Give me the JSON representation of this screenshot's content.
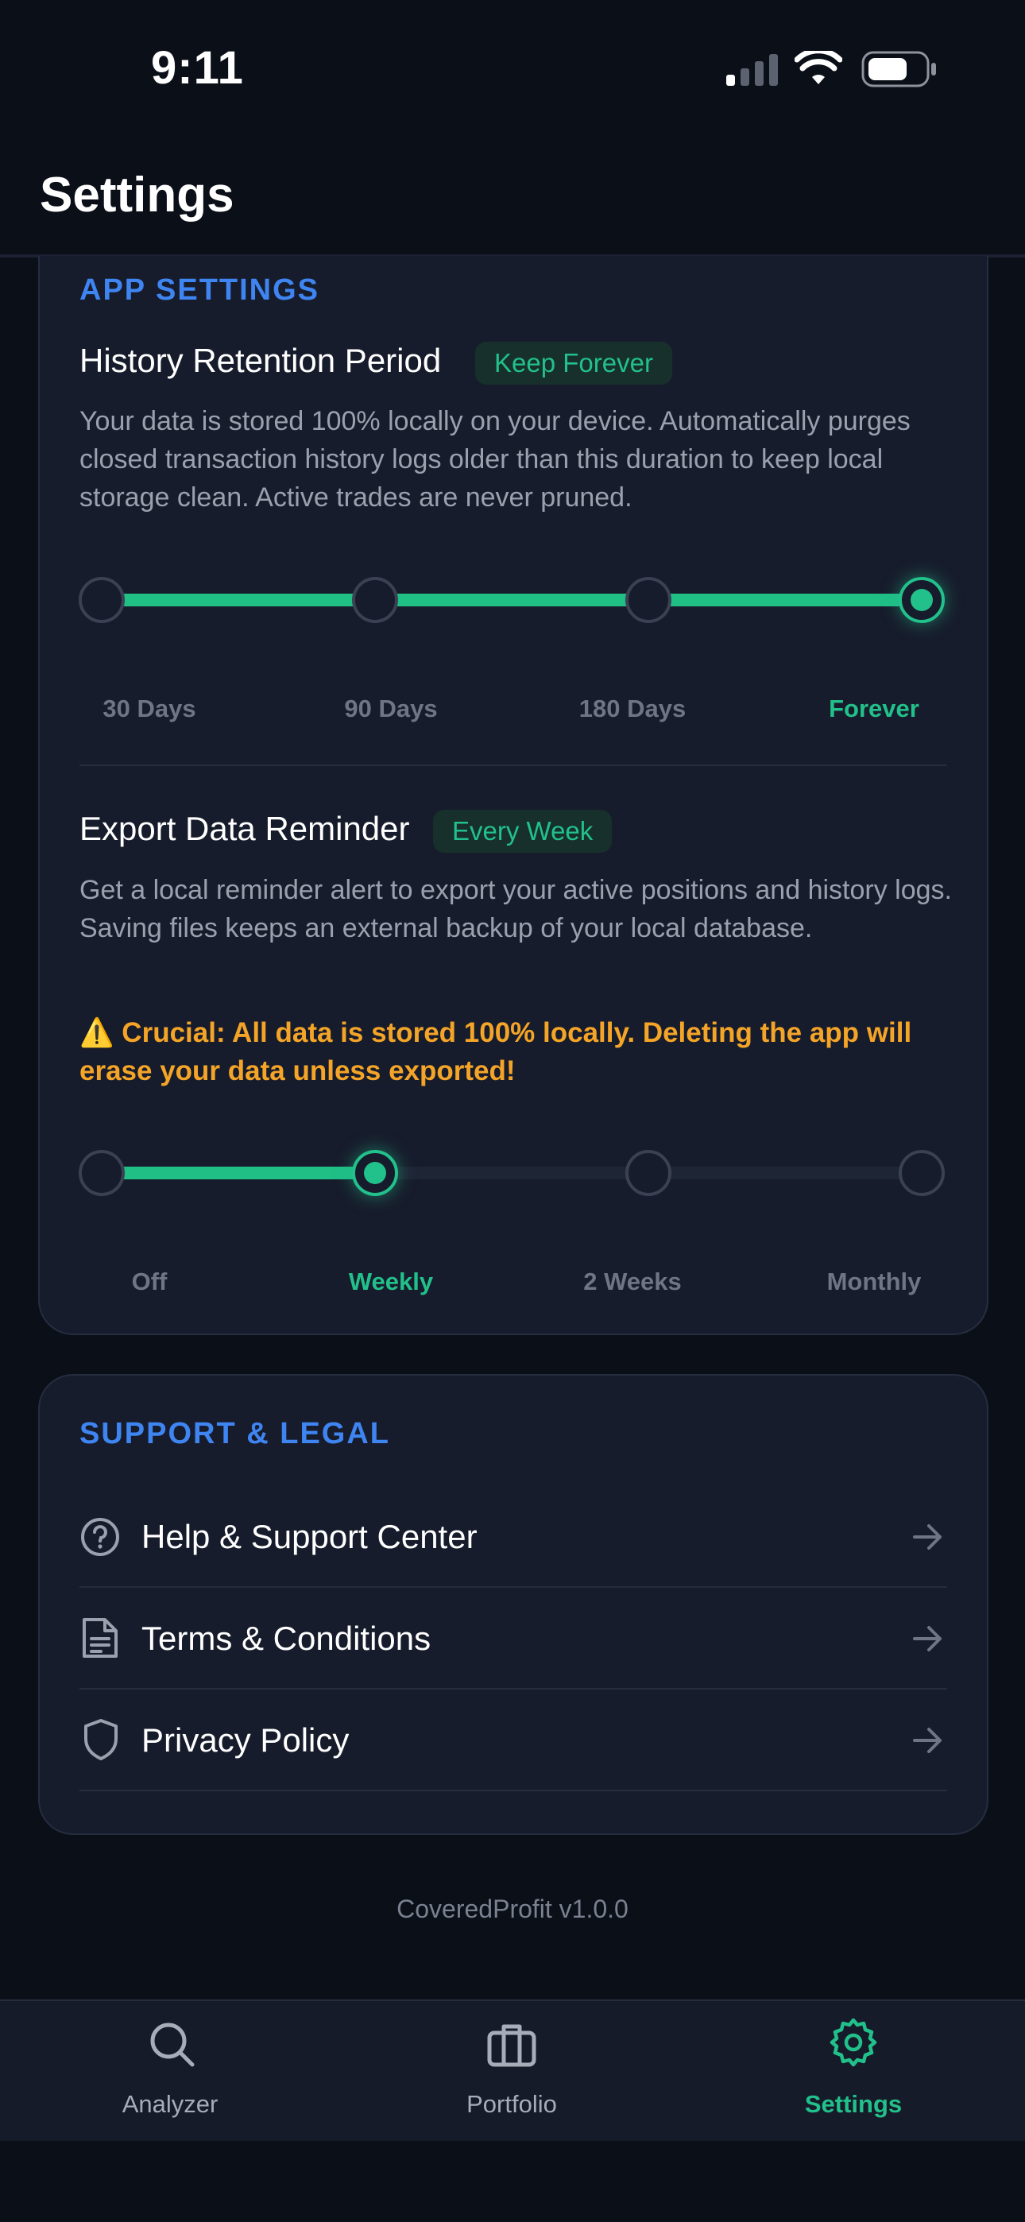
{
  "status_bar": {
    "time": "9:11"
  },
  "header": {
    "title": "Settings"
  },
  "app_settings": {
    "section_title": "APP SETTINGS",
    "history": {
      "title": "History Retention Period",
      "badge": "Keep Forever",
      "description": "Your data is stored 100% locally on your device. Automatically purges closed transaction history logs older than this duration to keep local storage clean. Active trades are never pruned.",
      "options": [
        "30 Days",
        "90 Days",
        "180 Days",
        "Forever"
      ],
      "selected_index": 3
    },
    "export": {
      "title": "Export Data Reminder",
      "badge": "Every Week",
      "description": "Get a local reminder alert to export your active positions and history logs. Saving files keeps an external backup of your local database.",
      "warning": "⚠️ Crucial: All data is stored 100% locally. Deleting the app will erase your data unless exported!",
      "options": [
        "Off",
        "Weekly",
        "2 Weeks",
        "Monthly"
      ],
      "selected_index": 1
    }
  },
  "support": {
    "section_title": "SUPPORT & LEGAL",
    "items": [
      {
        "label": "Help & Support Center",
        "icon": "help-circle-icon"
      },
      {
        "label": "Terms & Conditions",
        "icon": "document-icon"
      },
      {
        "label": "Privacy Policy",
        "icon": "shield-icon"
      }
    ]
  },
  "footer": {
    "version": "CoveredProfit v1.0.0"
  },
  "tabbar": {
    "tabs": [
      {
        "label": "Analyzer",
        "icon": "search-icon"
      },
      {
        "label": "Portfolio",
        "icon": "briefcase-icon"
      },
      {
        "label": "Settings",
        "icon": "gear-icon"
      }
    ],
    "selected_index": 2
  },
  "colors": {
    "accent": "#22c08a",
    "section": "#3f85f2",
    "warning": "#f4a427",
    "background": "#0b0f18",
    "card": "#171c2c"
  }
}
